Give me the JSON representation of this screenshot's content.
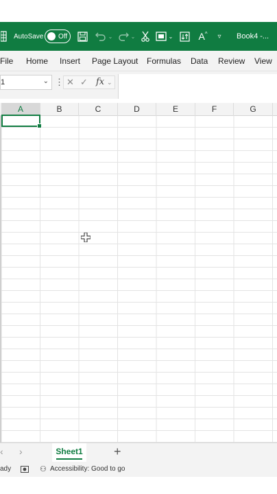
{
  "titlebar": {
    "autosave_label": "AutoSave",
    "autosave_state": "Off",
    "workbook_title": "Book4 -..."
  },
  "menu": {
    "items": [
      "File",
      "Home",
      "Insert",
      "Page Layout",
      "Formulas",
      "Data",
      "Review",
      "View"
    ]
  },
  "formula_bar": {
    "name_box": "1",
    "fx_label": "fx",
    "formula_value": ""
  },
  "grid": {
    "columns": [
      "A",
      "B",
      "C",
      "D",
      "E",
      "F",
      "G"
    ],
    "active_column": "A"
  },
  "sheets": {
    "tabs": [
      "Sheet1"
    ],
    "add_label": "+"
  },
  "status": {
    "ready_text": "ady",
    "accessibility_text": "Accessibility: Good to go"
  },
  "colors": {
    "brand_green": "#107c41"
  }
}
